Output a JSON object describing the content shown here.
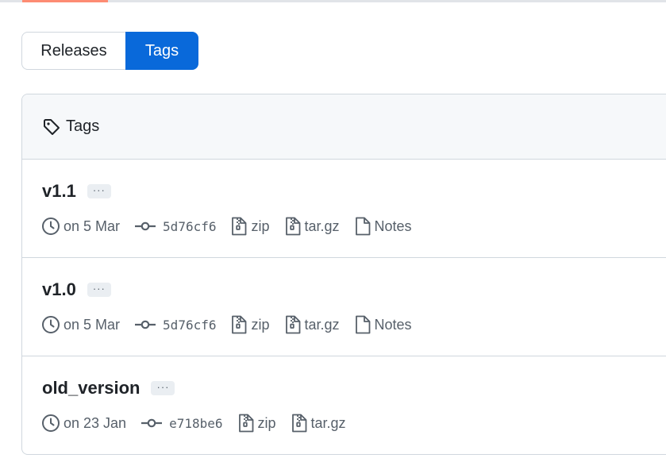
{
  "nav": {
    "selected_tab": "Tags"
  },
  "segmented": {
    "releases_label": "Releases",
    "tags_label": "Tags"
  },
  "box": {
    "header_title": "Tags"
  },
  "tags": [
    {
      "name": "v1.1",
      "date": "on 5 Mar",
      "commit": "5d76cf6",
      "zip": "zip",
      "targz": "tar.gz",
      "notes": "Notes"
    },
    {
      "name": "v1.0",
      "date": "on 5 Mar",
      "commit": "5d76cf6",
      "zip": "zip",
      "targz": "tar.gz",
      "notes": "Notes"
    },
    {
      "name": "old_version",
      "date": "on 23 Jan",
      "commit": "e718be6",
      "zip": "zip",
      "targz": "tar.gz"
    }
  ],
  "ellipsis": "···",
  "colors": {
    "accent": "#0969da",
    "tab_underline": "#fd8c73",
    "muted": "#57606a",
    "border": "#d0d7de"
  },
  "icons": {
    "header": "tag-icon",
    "date": "clock-icon",
    "commit": "commit-icon",
    "archive": "file-zip-icon",
    "notes": "file-icon"
  }
}
